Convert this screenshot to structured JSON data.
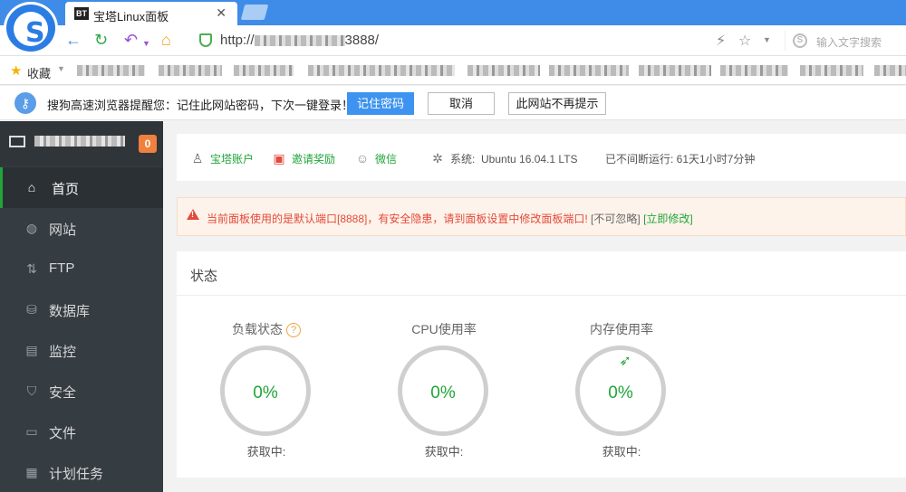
{
  "browser": {
    "tab_favicon": "BT",
    "tab_title": "宝塔Linux面板",
    "url_prefix": "http://",
    "url_suffix": "3888/",
    "search_placeholder": "输入文字搜索",
    "bookmarks_label": "收藏"
  },
  "password_prompt": {
    "message": "搜狗高速浏览器提醒您：记住此网站密码，下次一键登录！",
    "remember_label": "记住密码",
    "cancel_label": "取消",
    "never_label": "此网站不再提示"
  },
  "sidebar": {
    "badge": "0",
    "items": [
      {
        "label": "首页",
        "icon": "home-icon"
      },
      {
        "label": "网站",
        "icon": "globe-icon"
      },
      {
        "label": "FTP",
        "icon": "ftp-icon"
      },
      {
        "label": "数据库",
        "icon": "database-icon"
      },
      {
        "label": "监控",
        "icon": "monitor-icon"
      },
      {
        "label": "安全",
        "icon": "shield-icon"
      },
      {
        "label": "文件",
        "icon": "folder-icon"
      },
      {
        "label": "计划任务",
        "icon": "calendar-icon"
      }
    ]
  },
  "infobar": {
    "account": "宝塔账户",
    "invite": "邀请奖励",
    "wechat": "微信",
    "system_label": "系统:",
    "system_value": "Ubuntu 16.04.1 LTS",
    "uptime": "已不间断运行: 61天1小时7分钟"
  },
  "warning": {
    "text": "当前面板使用的是默认端口[8888]，有安全隐患，请到面板设置中修改面板端口!",
    "ignore": "[不可忽略]",
    "fix_link": "[立即修改]"
  },
  "status": {
    "title": "状态",
    "gauges": [
      {
        "title": "负载状态",
        "value": "0%",
        "sub": "获取中:"
      },
      {
        "title": "CPU使用率",
        "value": "0%",
        "sub": "获取中:"
      },
      {
        "title": "内存使用率",
        "value": "0%",
        "sub": "获取中:"
      }
    ]
  },
  "colors": {
    "accent_green": "#20a53a",
    "sidebar_bg": "#353c42",
    "browser_blue": "#3f8ce8",
    "warning_red": "#e24a3b",
    "badge_orange": "#f0803c"
  }
}
